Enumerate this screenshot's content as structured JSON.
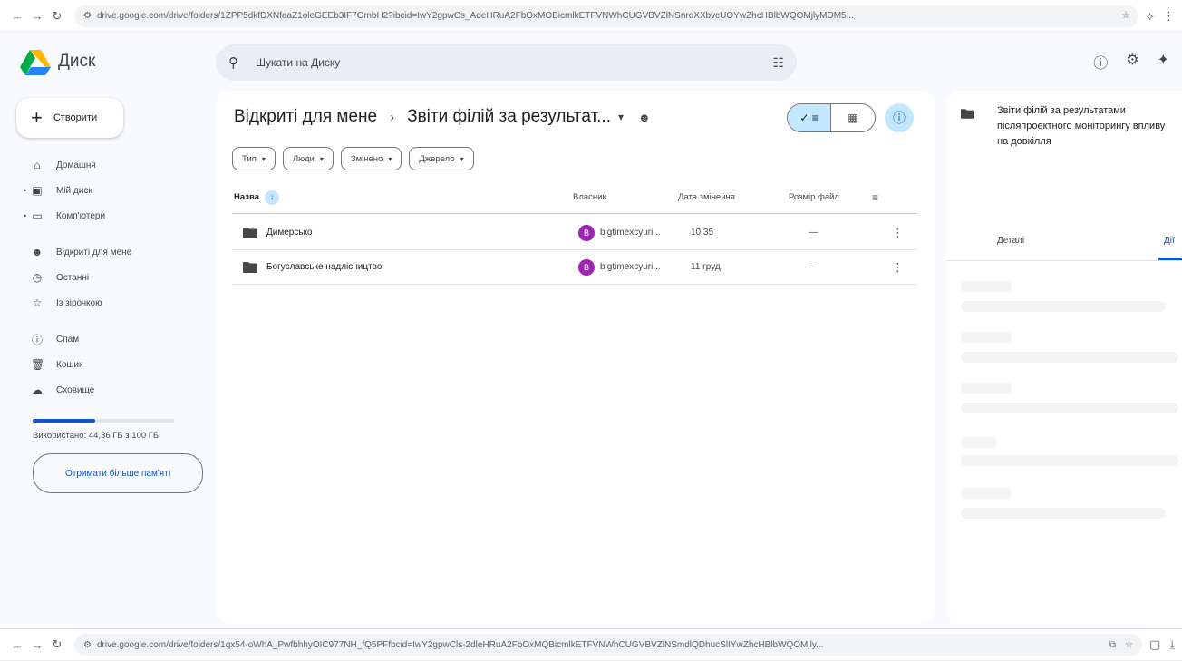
{
  "browser_top": {
    "url": "drive.google.com/drive/folders/1ZPP5dkfDXNfaaZ1oleGEEb3IF7OmbH2?ibcid=IwY2gpwCs_AdeHRuA2FbOxMOBicmlkETFVNWhCUGVBVZlNSnrdXXbvcUOYwZhcHBlbWQOMjlyMDM5...",
    "site_icon": "tune-icon"
  },
  "browser_bottom": {
    "url": "drive.google.com/drive/folders/1qx54-oWhA_PwfbhhyOIC977NH_fQ5PFfbcid=IwY2gpwCls-2dleHRuA2FbOxMQBicmlkETFVNWhCUGVBVZlNSmdlQDhucSlIYwZhcHBlbWQOMjly..."
  },
  "app": {
    "logo_text": "Диск",
    "search_placeholder": "Шукати на Диску"
  },
  "sidebar": {
    "create_label": "Створити",
    "items": [
      {
        "label": "Домашня",
        "icon": "home-icon"
      },
      {
        "label": "Мій диск",
        "icon": "my-drive-icon"
      },
      {
        "label": "Комп'ютери",
        "icon": "computer-icon"
      },
      {
        "label": "Відкриті для мене",
        "icon": "shared-icon"
      },
      {
        "label": "Останні",
        "icon": "clock-icon"
      },
      {
        "label": "Із зірочкою",
        "icon": "star-icon"
      },
      {
        "label": "Спам",
        "icon": "spam-icon"
      },
      {
        "label": "Кошик",
        "icon": "trash-icon"
      },
      {
        "label": "Сховище",
        "icon": "cloud-icon"
      }
    ],
    "storage_text": "Використано: 44,36 ГБ з 100 ГБ",
    "storage_fraction": 0.44,
    "more_storage_label": "Отримати більше пам'яті"
  },
  "main": {
    "breadcrumb_root": "Відкриті для мене",
    "breadcrumb_current": "Звіти філій за результат...",
    "filters": [
      {
        "label": "Тип"
      },
      {
        "label": "Люди"
      },
      {
        "label": "Змінено"
      },
      {
        "label": "Джерело"
      }
    ],
    "columns": {
      "name": "Назва",
      "owner": "Власник",
      "modified": "Дата змінення",
      "size": "Розмір файл"
    },
    "rows": [
      {
        "name": "Димерсько",
        "owner": "bigtimexcyuri...",
        "avatar": "B",
        "modified": "10:35",
        "size": "—"
      },
      {
        "name": "Богуславське надлісництво",
        "owner": "bigtimexcyuri...",
        "avatar": "B",
        "modified": "11 груд.",
        "size": "—"
      }
    ]
  },
  "details": {
    "title": "Звіти філій за результатами післяпроектного моніторингу впливу на довкілля",
    "tab_details": "Деталі",
    "tab_activity": "Дії"
  }
}
